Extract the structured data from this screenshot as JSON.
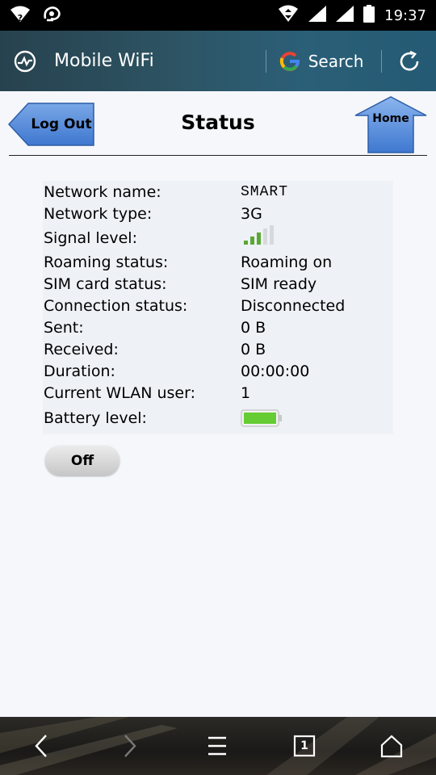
{
  "statusbar": {
    "time": "19:37",
    "icons": [
      "wifi-question-icon",
      "uc-browser-icon",
      "data-transfer-icon",
      "signal-icon",
      "signal-icon",
      "battery-icon"
    ]
  },
  "toolbar": {
    "title": "Mobile WiFi",
    "search_label": "Search",
    "icons": [
      "pulse-icon",
      "google-icon",
      "refresh-icon"
    ]
  },
  "page": {
    "title": "Status",
    "logout_label": "Log Out",
    "home_label": "Home"
  },
  "status": {
    "rows": [
      {
        "label": "Network name:",
        "value": "SMART"
      },
      {
        "label": "Network type:",
        "value": "3G"
      },
      {
        "label": "Signal level:",
        "value": ""
      },
      {
        "label": "Roaming status:",
        "value": "Roaming on"
      },
      {
        "label": "SIM card status:",
        "value": "SIM ready"
      },
      {
        "label": "Connection status:",
        "value": "Disconnected"
      },
      {
        "label": "Sent:",
        "value": "0 B"
      },
      {
        "label": "Received:",
        "value": "0 B"
      },
      {
        "label": "Duration:",
        "value": "00:00:00"
      },
      {
        "label": "Current WLAN user:",
        "value": "1"
      },
      {
        "label": "Battery level:",
        "value": ""
      }
    ],
    "signal_bars_filled": 3,
    "signal_bars_total": 5,
    "battery_fraction": 1.0,
    "battery_color": "#66cc33",
    "signal_color": "#5aa832",
    "off_label": "Off"
  },
  "navbar": {
    "icons": [
      "back-icon",
      "forward-icon",
      "menu-icon",
      "tabs-icon",
      "home-icon"
    ],
    "tab_count": "1"
  }
}
